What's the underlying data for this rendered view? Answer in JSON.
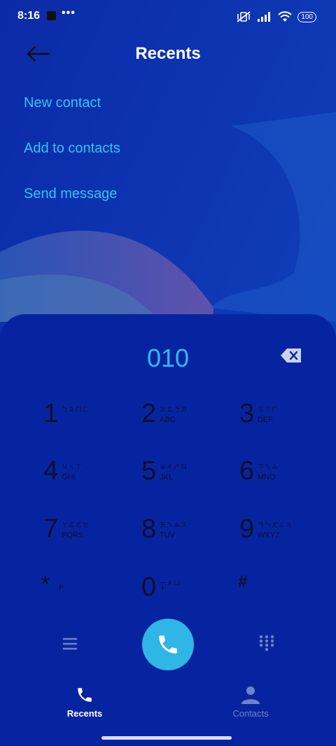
{
  "status": {
    "time": "8:16",
    "dots": "•••",
    "battery": "100"
  },
  "header": {
    "title": "Recents"
  },
  "menu": {
    "new_contact": "New contact",
    "add_to_contacts": "Add to contacts",
    "send_message": "Send message"
  },
  "dialer": {
    "number": "010",
    "keys": [
      {
        "digit": "1",
        "zhuyin": "ㄅㄆㄇㄈ",
        "letters": ""
      },
      {
        "digit": "2",
        "zhuyin": "ㄉㄊㄋㄌ",
        "letters": "ABC"
      },
      {
        "digit": "3",
        "zhuyin": "ㄍㄎㄏ",
        "letters": "DEF"
      },
      {
        "digit": "4",
        "zhuyin": "ㄐㄑㄒ",
        "letters": "GHI"
      },
      {
        "digit": "5",
        "zhuyin": "ㄓㄔㄕㄖ",
        "letters": "JKL"
      },
      {
        "digit": "6",
        "zhuyin": "ㄗㄘㄙ",
        "letters": "MNO"
      },
      {
        "digit": "7",
        "zhuyin": "ㄚㄛㄜㄝ",
        "letters": "PQRS"
      },
      {
        "digit": "8",
        "zhuyin": "ㄞㄟㄠㄡ",
        "letters": "TUV"
      },
      {
        "digit": "9",
        "zhuyin": "ㄢㄣㄤㄥㄦ",
        "letters": "WXYZ"
      },
      {
        "digit": "*",
        "zhuyin": "",
        "letters": "P"
      },
      {
        "digit": "0",
        "zhuyin": "ㄧㄨㄩ",
        "letters": "+"
      },
      {
        "digit": "#",
        "zhuyin": "",
        "letters": ""
      }
    ]
  },
  "nav": {
    "recents": "Recents",
    "contacts": "Contacts"
  },
  "colors": {
    "accent": "#34b9ee",
    "background": "#0a2a9e",
    "call": "#2fb6e6"
  }
}
